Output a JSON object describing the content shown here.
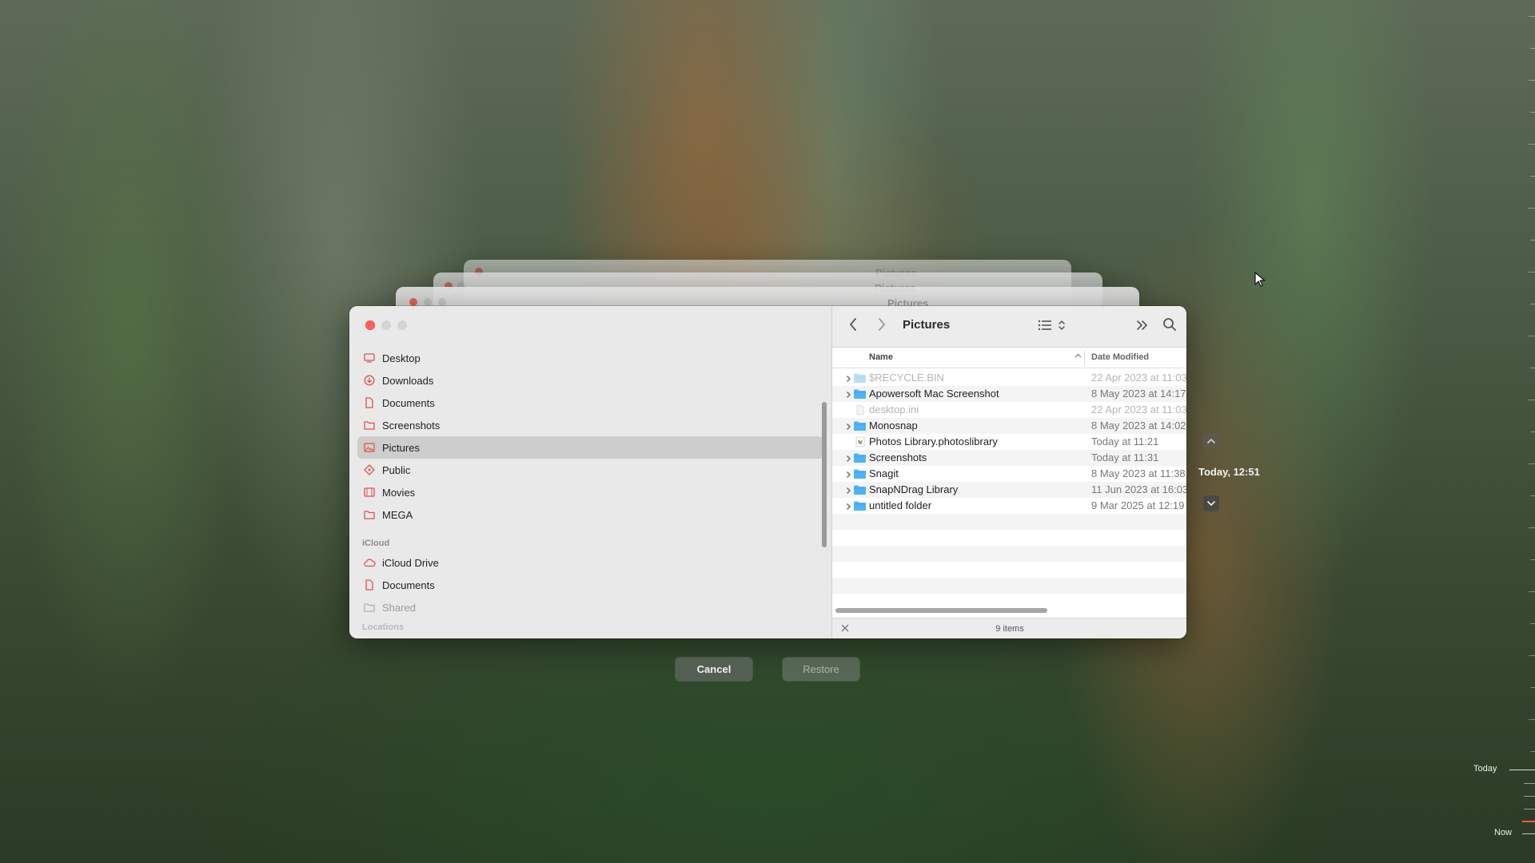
{
  "sidebar": {
    "items": [
      {
        "label": "Desktop",
        "icon": "desktop-icon"
      },
      {
        "label": "Downloads",
        "icon": "downloads-icon"
      },
      {
        "label": "Documents",
        "icon": "document-icon"
      },
      {
        "label": "Screenshots",
        "icon": "folder-icon"
      },
      {
        "label": "Pictures",
        "icon": "pictures-icon",
        "selected": true
      },
      {
        "label": "Public",
        "icon": "public-icon"
      },
      {
        "label": "Movies",
        "icon": "movies-icon"
      },
      {
        "label": "MEGA",
        "icon": "folder-icon"
      }
    ],
    "icloud_section": "iCloud",
    "icloud_items": [
      {
        "label": "iCloud Drive",
        "icon": "cloud-icon"
      },
      {
        "label": "Documents",
        "icon": "document-icon"
      },
      {
        "label": "Shared",
        "icon": "shared-folder-icon",
        "dim": true
      }
    ],
    "locations_section": "Locations"
  },
  "toolbar": {
    "title": "Pictures"
  },
  "columns": {
    "name": "Name",
    "date": "Date Modified"
  },
  "files": [
    {
      "name": "$RECYCLE.BIN",
      "date": "22 Apr 2023 at 11:03",
      "type": "folder",
      "dim": true
    },
    {
      "name": "Apowersoft Mac Screenshot",
      "date": "8 May 2023 at 14:17",
      "type": "folder"
    },
    {
      "name": "desktop.ini",
      "date": "22 Apr 2023 at 11:03",
      "type": "file",
      "dim": true
    },
    {
      "name": "Monosnap",
      "date": "8 May 2023 at 14:02",
      "type": "folder"
    },
    {
      "name": "Photos Library.photoslibrary",
      "date": "Today at 11:21",
      "type": "photos"
    },
    {
      "name": "Screenshots",
      "date": "Today at 11:31",
      "type": "folder"
    },
    {
      "name": "Snagit",
      "date": "8 May 2023 at 11:38",
      "type": "folder"
    },
    {
      "name": "SnapNDrag Library",
      "date": "11 Jun 2023 at 16:03",
      "type": "folder"
    },
    {
      "name": "untitled folder",
      "date": "9 Mar 2025 at 12:19",
      "type": "folder"
    }
  ],
  "status": {
    "count": "9 items"
  },
  "buttons": {
    "cancel": "Cancel",
    "restore": "Restore"
  },
  "time_machine": {
    "current": "Today, 12:51",
    "timeline_top": "Today",
    "timeline_bottom": "Now"
  },
  "ghost_windows": [
    {
      "title": "Pictures"
    },
    {
      "title": "Pictures"
    },
    {
      "title": "Pictures"
    }
  ],
  "colors": {
    "accent_folder": "#4fb3f5",
    "close_red": "#ff5f57",
    "sidebar_icon_red": "#e0524f"
  }
}
